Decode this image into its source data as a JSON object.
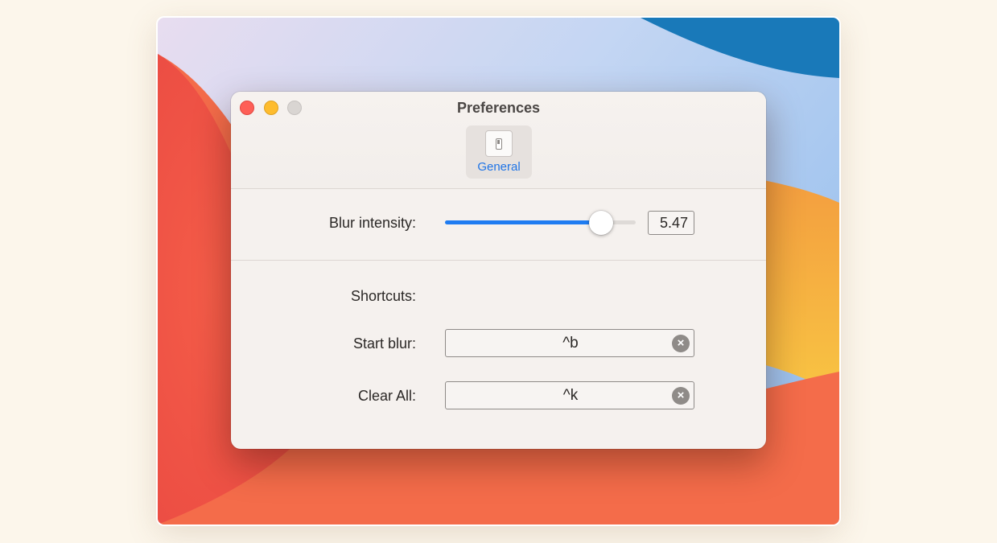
{
  "window": {
    "title": "Preferences"
  },
  "toolbar": {
    "tabs": [
      {
        "label": "General",
        "icon": "switch-icon",
        "selected": true
      }
    ]
  },
  "blur": {
    "label": "Blur intensity:",
    "value": "5.47",
    "slider_fraction": 0.82
  },
  "shortcuts": {
    "heading": "Shortcuts:",
    "items": [
      {
        "label": "Start blur:",
        "value": "^b"
      },
      {
        "label": "Clear All:",
        "value": "^k"
      }
    ]
  },
  "colors": {
    "accent": "#1f7cf1",
    "tab_label": "#1f74e6",
    "window_bg": "#f5f1ee",
    "traffic_close": "#fe5f57",
    "traffic_minimize": "#febc2e",
    "traffic_zoom_disabled": "#d9d5d2",
    "page_bg": "#fcf6eb"
  }
}
